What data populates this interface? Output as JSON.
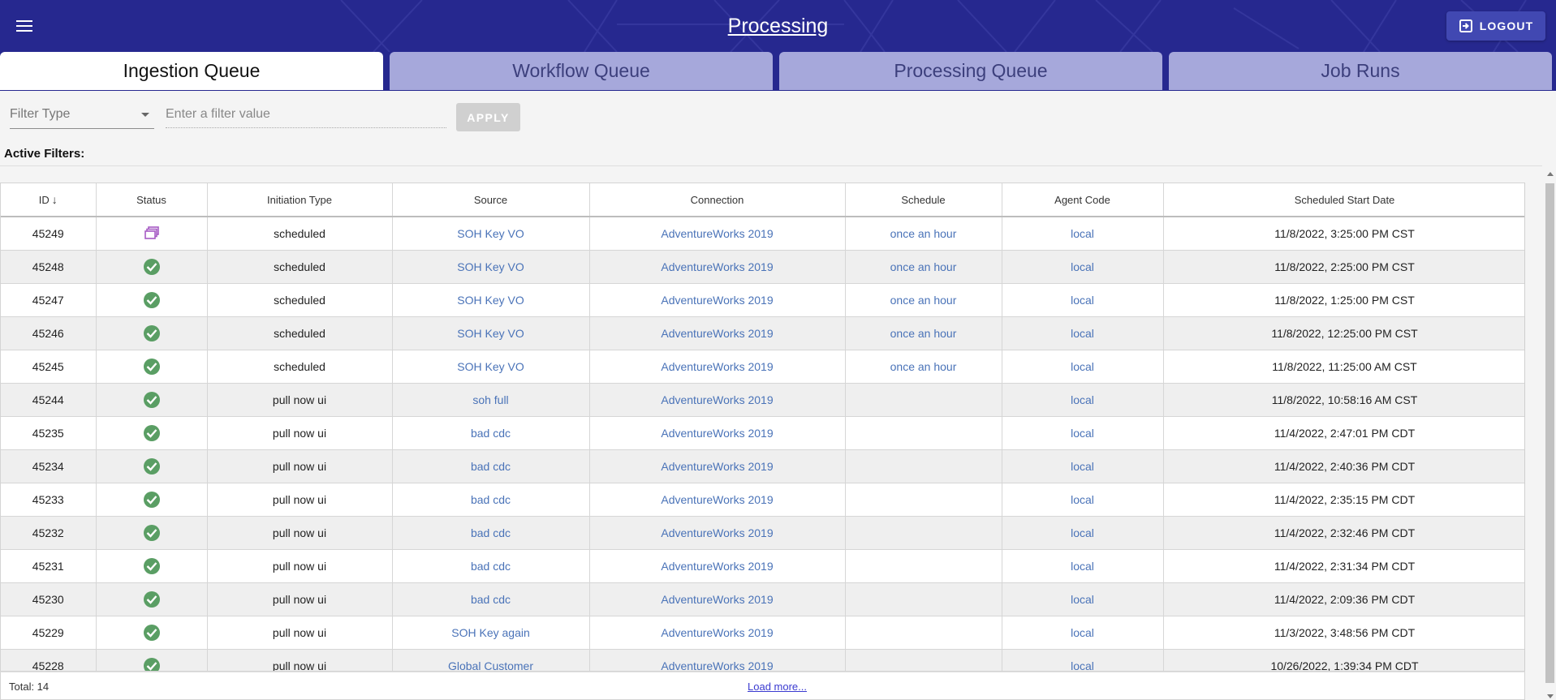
{
  "header": {
    "title": "Processing",
    "logout_label": "LOGOUT"
  },
  "tabs": [
    {
      "label": "Ingestion Queue",
      "active": true
    },
    {
      "label": "Workflow Queue",
      "active": false
    },
    {
      "label": "Processing Queue",
      "active": false
    },
    {
      "label": "Job Runs",
      "active": false
    }
  ],
  "filter": {
    "type_placeholder": "Filter Type",
    "value_placeholder": "Enter a filter value",
    "apply_label": "APPLY",
    "active_filters_label": "Active Filters:"
  },
  "table": {
    "columns": [
      "ID",
      "Status",
      "Initiation Type",
      "Source",
      "Connection",
      "Schedule",
      "Agent Code",
      "Scheduled Start Date"
    ],
    "sort_indicator": "↓",
    "rows": [
      {
        "id": "45249",
        "status": "running",
        "initiation": "scheduled",
        "source": "SOH Key VO",
        "connection": "AdventureWorks 2019",
        "schedule": "once an hour",
        "agent": "local",
        "start": "11/8/2022, 3:25:00 PM CST"
      },
      {
        "id": "45248",
        "status": "success",
        "initiation": "scheduled",
        "source": "SOH Key VO",
        "connection": "AdventureWorks 2019",
        "schedule": "once an hour",
        "agent": "local",
        "start": "11/8/2022, 2:25:00 PM CST"
      },
      {
        "id": "45247",
        "status": "success",
        "initiation": "scheduled",
        "source": "SOH Key VO",
        "connection": "AdventureWorks 2019",
        "schedule": "once an hour",
        "agent": "local",
        "start": "11/8/2022, 1:25:00 PM CST"
      },
      {
        "id": "45246",
        "status": "success",
        "initiation": "scheduled",
        "source": "SOH Key VO",
        "connection": "AdventureWorks 2019",
        "schedule": "once an hour",
        "agent": "local",
        "start": "11/8/2022, 12:25:00 PM CST"
      },
      {
        "id": "45245",
        "status": "success",
        "initiation": "scheduled",
        "source": "SOH Key VO",
        "connection": "AdventureWorks 2019",
        "schedule": "once an hour",
        "agent": "local",
        "start": "11/8/2022, 11:25:00 AM CST"
      },
      {
        "id": "45244",
        "status": "success",
        "initiation": "pull now ui",
        "source": "soh full",
        "connection": "AdventureWorks 2019",
        "schedule": "",
        "agent": "local",
        "start": "11/8/2022, 10:58:16 AM CST"
      },
      {
        "id": "45235",
        "status": "success",
        "initiation": "pull now ui",
        "source": "bad cdc",
        "connection": "AdventureWorks 2019",
        "schedule": "",
        "agent": "local",
        "start": "11/4/2022, 2:47:01 PM CDT"
      },
      {
        "id": "45234",
        "status": "success",
        "initiation": "pull now ui",
        "source": "bad cdc",
        "connection": "AdventureWorks 2019",
        "schedule": "",
        "agent": "local",
        "start": "11/4/2022, 2:40:36 PM CDT"
      },
      {
        "id": "45233",
        "status": "success",
        "initiation": "pull now ui",
        "source": "bad cdc",
        "connection": "AdventureWorks 2019",
        "schedule": "",
        "agent": "local",
        "start": "11/4/2022, 2:35:15 PM CDT"
      },
      {
        "id": "45232",
        "status": "success",
        "initiation": "pull now ui",
        "source": "bad cdc",
        "connection": "AdventureWorks 2019",
        "schedule": "",
        "agent": "local",
        "start": "11/4/2022, 2:32:46 PM CDT"
      },
      {
        "id": "45231",
        "status": "success",
        "initiation": "pull now ui",
        "source": "bad cdc",
        "connection": "AdventureWorks 2019",
        "schedule": "",
        "agent": "local",
        "start": "11/4/2022, 2:31:34 PM CDT"
      },
      {
        "id": "45230",
        "status": "success",
        "initiation": "pull now ui",
        "source": "bad cdc",
        "connection": "AdventureWorks 2019",
        "schedule": "",
        "agent": "local",
        "start": "11/4/2022, 2:09:36 PM CDT"
      },
      {
        "id": "45229",
        "status": "success",
        "initiation": "pull now ui",
        "source": "SOH Key again",
        "connection": "AdventureWorks 2019",
        "schedule": "",
        "agent": "local",
        "start": "11/3/2022, 3:48:56 PM CDT"
      },
      {
        "id": "45228",
        "status": "success",
        "initiation": "pull now ui",
        "source": "Global Customer",
        "connection": "AdventureWorks 2019",
        "schedule": "",
        "agent": "local",
        "start": "10/26/2022, 1:39:34 PM CDT"
      }
    ]
  },
  "footer": {
    "total_label": "Total: 14",
    "load_more_label": "Load more..."
  },
  "colors": {
    "header": "#26288f",
    "tab_inactive": "#a6a8db",
    "link": "#4a73b8",
    "status_success": "#5a9e64",
    "status_running": "#a65cc4"
  },
  "icons": {
    "menu": "hamburger-menu-icon",
    "logout": "logout-icon",
    "success": "check-circle-icon",
    "running": "queue-icon",
    "dropdown": "caret-down-icon"
  }
}
